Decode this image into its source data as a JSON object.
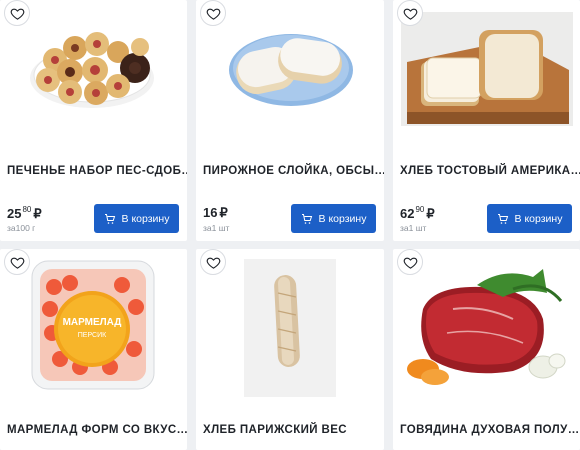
{
  "products": [
    {
      "title": "ПЕЧЕНЬЕ НАБОР ПЕС-СДОБ…",
      "price_main": "25",
      "price_fraction": "80",
      "currency": "₽",
      "unit": "за100 г",
      "cart_label": "В корзину"
    },
    {
      "title": "ПИРОЖНОЕ СЛОЙКА, ОБСЫ…",
      "price_main": "16",
      "price_fraction": "",
      "currency": "₽",
      "unit": "за1 шт",
      "cart_label": "В корзину"
    },
    {
      "title": "ХЛЕБ ТОСТОВЫЙ АМЕРИКА…",
      "price_main": "62",
      "price_fraction": "90",
      "currency": "₽",
      "unit": "за1 шт",
      "cart_label": "В корзину"
    },
    {
      "title": "МАРМЕЛАД ФОРМ СО ВКУС…"
    },
    {
      "title": "ХЛЕБ ПАРИЖСКИЙ ВЕС"
    },
    {
      "title": "ГОВЯДИНА ДУХОВАЯ ПОЛУ…"
    }
  ],
  "package_label": {
    "line1": "МАРМЕЛАД",
    "line2": "ПЕРСИК"
  },
  "colors": {
    "accent": "#1c5fc7",
    "background": "#eef0f3",
    "card": "#ffffff"
  },
  "icons": {
    "favorite": "heart-icon",
    "cart": "cart-icon"
  }
}
